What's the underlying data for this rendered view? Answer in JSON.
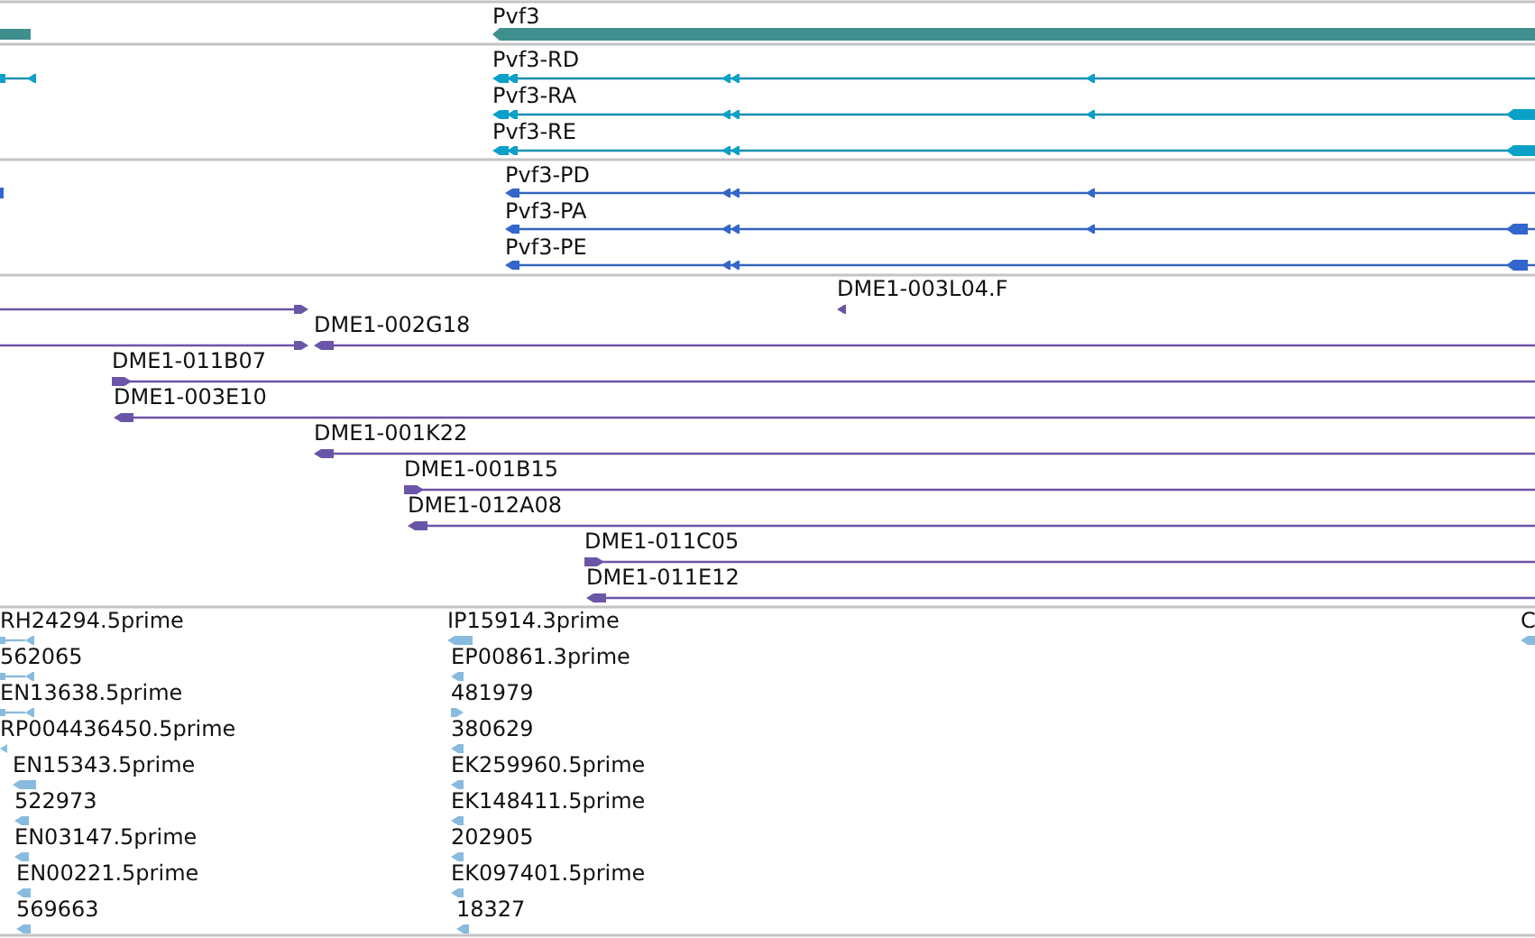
{
  "gene_track": {
    "genes": [
      {
        "label": "Pvf3",
        "reverse": true
      }
    ]
  },
  "transcript_track": {
    "transcripts": [
      {
        "label": "Pvf3-RD",
        "reverse": true
      },
      {
        "label": "Pvf3-RA",
        "reverse": true
      },
      {
        "label": "Pvf3-RE",
        "reverse": true
      }
    ]
  },
  "protein_track": {
    "proteins": [
      {
        "label": "Pvf3-PD",
        "reverse": true
      },
      {
        "label": "Pvf3-PA",
        "reverse": true
      },
      {
        "label": "Pvf3-PE",
        "reverse": true
      }
    ]
  },
  "clone_track": {
    "clones": [
      {
        "label": "DME1-003L04.F",
        "reverse": true
      },
      {
        "label": "DME1-002G18",
        "reverse": true
      },
      {
        "label": "DME1-011B07",
        "reverse": false
      },
      {
        "label": "DME1-003E10",
        "reverse": true
      },
      {
        "label": "DME1-001K22",
        "reverse": true
      },
      {
        "label": "DME1-001B15",
        "reverse": false
      },
      {
        "label": "DME1-012A08",
        "reverse": true
      },
      {
        "label": "DME1-011C05",
        "reverse": false
      },
      {
        "label": "DME1-011E12",
        "reverse": true
      }
    ]
  },
  "est_track": {
    "columns": [
      {
        "ests": [
          {
            "label": "RH24294.5prime",
            "reverse": true
          },
          {
            "label": "562065",
            "reverse": true
          },
          {
            "label": "EN13638.5prime",
            "reverse": true
          },
          {
            "label": "RP004436450.5prime",
            "reverse": true
          },
          {
            "label": "EN15343.5prime",
            "reverse": true
          },
          {
            "label": "522973",
            "reverse": true
          },
          {
            "label": "EN03147.5prime",
            "reverse": true
          },
          {
            "label": "EN00221.5prime",
            "reverse": true
          },
          {
            "label": "569663",
            "reverse": true
          }
        ]
      },
      {
        "ests": [
          {
            "label": "IP15914.3prime",
            "reverse": true
          },
          {
            "label": "EP00861.3prime",
            "reverse": true
          },
          {
            "label": "481979",
            "reverse": false
          },
          {
            "label": "380629",
            "reverse": true
          },
          {
            "label": "EK259960.5prime",
            "reverse": true
          },
          {
            "label": "EK148411.5prime",
            "reverse": true
          },
          {
            "label": "202905",
            "reverse": true
          },
          {
            "label": "EK097401.5prime",
            "reverse": true
          },
          {
            "label": "18327",
            "reverse": true
          }
        ]
      },
      {
        "ests": [
          {
            "label": "C",
            "reverse": true
          }
        ]
      }
    ]
  }
}
